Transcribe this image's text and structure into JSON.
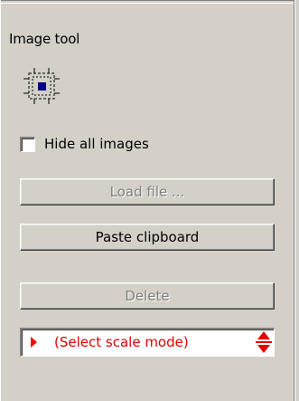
{
  "panel": {
    "title": "Image tool",
    "tool_icon": "image-selection-icon",
    "hide_images": {
      "label": "Hide all images",
      "checked": false
    },
    "buttons": {
      "load_file": {
        "label": "Load file ...",
        "enabled": false
      },
      "paste_clipboard": {
        "label": "Paste clipboard",
        "enabled": true
      },
      "delete": {
        "label": "Delete",
        "enabled": false
      }
    },
    "scale_mode": {
      "value": "(Select scale mode)",
      "indicator_icon": "red-triangle-right-icon",
      "spinner_icon": "up-down-spinner-icon",
      "text_color": "#e00000"
    }
  }
}
